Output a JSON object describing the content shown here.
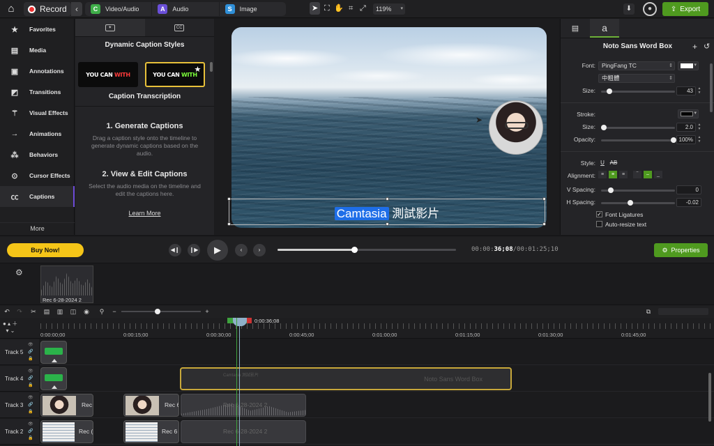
{
  "topbar": {
    "record_label": "Record",
    "media_tabs": [
      {
        "label": "Video/Audio",
        "icon": "C",
        "color": "#3fae49"
      },
      {
        "label": "Audio",
        "icon": "A",
        "color": "#6a4fd8"
      },
      {
        "label": "Image",
        "icon": "S",
        "color": "#2f8fd8"
      }
    ],
    "zoom": "119%",
    "export_label": "Export"
  },
  "sidebar": {
    "items": [
      {
        "label": "Favorites",
        "icon": "star-icon"
      },
      {
        "label": "Media",
        "icon": "film-icon"
      },
      {
        "label": "Annotations",
        "icon": "annotation-icon"
      },
      {
        "label": "Transitions",
        "icon": "transition-icon"
      },
      {
        "label": "Visual Effects",
        "icon": "wand-icon"
      },
      {
        "label": "Animations",
        "icon": "animation-icon"
      },
      {
        "label": "Behaviors",
        "icon": "behavior-icon"
      },
      {
        "label": "Cursor Effects",
        "icon": "cursor-icon"
      },
      {
        "label": "Captions",
        "icon": "cc-icon"
      }
    ],
    "more_label": "More"
  },
  "library": {
    "tab_cc": "CC",
    "title": "Dynamic Caption Styles",
    "thumb_text_a": "YOU CAN",
    "thumb_text_b": "WITH",
    "transcription_title": "Caption Transcription",
    "step1_title": "1. Generate Captions",
    "step1_text": "Drag a caption style onto the timeline to generate dynamic captions based on the audio.",
    "step2_title": "2. View & Edit Captions",
    "step2_text": "Select the audio media on the timeline and edit the captions here.",
    "learn_more": "Learn More"
  },
  "canvas": {
    "caption_highlight": "Camtasia",
    "caption_rest": "測試影片"
  },
  "properties": {
    "tab_text": "a",
    "title": "Noto Sans Word Box",
    "font_label": "Font:",
    "font_value": "PingFang TC",
    "weight_value": "中粗體",
    "size_label": "Size:",
    "size_value": "43",
    "stroke_label": "Stroke:",
    "stroke_size_label": "Size:",
    "stroke_size_value": "2.0",
    "opacity_label": "Opacity:",
    "opacity_value": "100%",
    "style_label": "Style:",
    "style_u": "U",
    "style_ab": "AB",
    "alignment_label": "Alignment:",
    "vspacing_label": "V Spacing:",
    "vspacing_value": "0",
    "hspacing_label": "H Spacing:",
    "hspacing_value": "-0.02",
    "ligatures_label": "Font Ligatures",
    "ligatures_checked": true,
    "autoresize_label": "Auto-resize text",
    "autoresize_checked": false,
    "font_color": "#ffffff",
    "stroke_color": "#000000"
  },
  "playback": {
    "buy_label": "Buy Now!",
    "time_prefix": "00:00:",
    "time_current": "36;08",
    "time_total": "/00:01:25;10",
    "progress": 0.43,
    "properties_label": "Properties"
  },
  "bin": {
    "item_label": "Rec 6-28-2024 2"
  },
  "timeline": {
    "playhead_time": "0:00:36;08",
    "ruler_labels": [
      "0:00:00;00",
      "0:00:15;00",
      "0:00:30;00",
      "0:00:45;00",
      "0:01:00;00",
      "0:01:15;00",
      "0:01:30;00",
      "0:01:45;00"
    ],
    "tracks": [
      "Track 5",
      "Track 4",
      "Track 3",
      "Track 2"
    ],
    "caption_clip_label": "Noto Sans Word Box",
    "caption_clip_sub": "Camtasia  測試影片",
    "clip_labels": [
      "Rec",
      "Rec 6",
      "Rec 6-28-2024 2",
      "Rec (",
      "Rec 6",
      "Rec 6-28-2024 2"
    ]
  }
}
